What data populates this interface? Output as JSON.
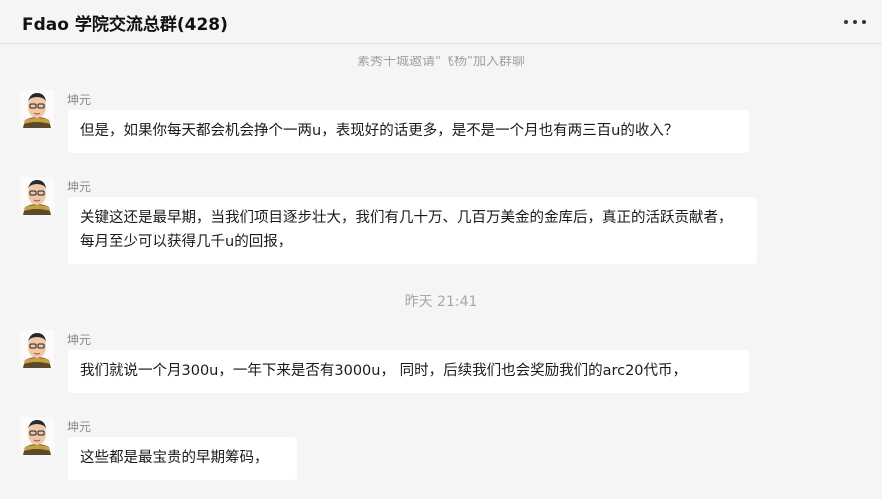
{
  "chat": {
    "title": "Fdao 学院交流总群(428)",
    "menu_icon": "more-dots-icon"
  },
  "system_message": "素秀千城邀请\"飞杨\"加入群聊",
  "timestamp": "昨天 21:41",
  "messages": [
    {
      "sender": "坤元",
      "text": "但是，如果你每天都会机会挣个一两u，表现好的话更多，是不是一个月也有两三百u的收入？"
    },
    {
      "sender": "坤元",
      "text": "关键这还是最早期，当我们项目逐步壮大，我们有几十万、几百万美金的金库后，真正的活跃贡献者，每月至少可以获得几千u的回报，"
    },
    {
      "sender": "坤元",
      "text": "我们就说一个月300u，一年下来是否有3000u， 同时，后续我们也会奖励我们的arc20代币，"
    },
    {
      "sender": "坤元",
      "text": "这些都是最宝贵的早期筹码，"
    }
  ]
}
